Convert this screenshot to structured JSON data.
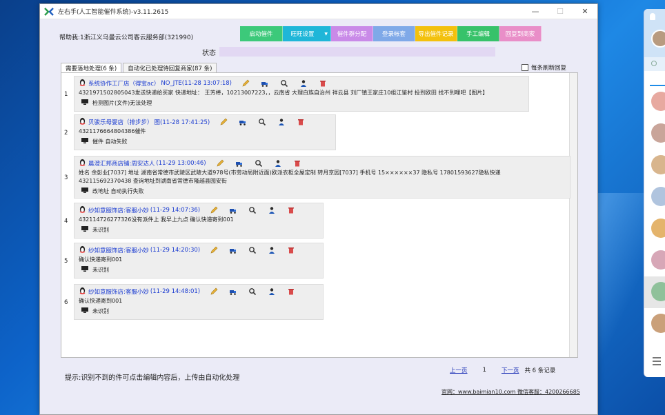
{
  "window": {
    "title": "左右手(人工智能催件系统)-v3.11.2615",
    "minimize": "—",
    "maximize": "☐",
    "close": "✕"
  },
  "account": {
    "label": "帮助我:1浙江义乌曼云公司客云服务部(321990)"
  },
  "toolbar": {
    "buttons": [
      {
        "label": "启动催件",
        "color": "#3cc97a"
      },
      {
        "label": "旺旺设置",
        "color": "#1fb6d8"
      },
      {
        "label": "催件群分配",
        "color": "#c98ae8"
      },
      {
        "label": "登录帐套",
        "color": "#7fa9e8"
      },
      {
        "label": "导出催件记录",
        "color": "#f3c10d"
      },
      {
        "label": "手工编辑",
        "color": "#37c26a"
      },
      {
        "label": "回复到商家",
        "color": "#e98ec8"
      }
    ],
    "dropdown_arrow": "▼"
  },
  "status": {
    "label": "状态"
  },
  "tabs": [
    {
      "label": "需要落地处理(6 条)",
      "active": true
    },
    {
      "label": "自动化已处理待回复商家(87 条)",
      "active": false
    }
  ],
  "refresh_option": {
    "label": "每条刷新回复",
    "checked": false
  },
  "messages": [
    {
      "num": "1",
      "shop": "系统协作工厂店（得宝ac）",
      "time": "NO_JTE(11-28 13:07:18)",
      "lines": [
        "4321971502805043发送快递给买家 快递地址： 王芳棒，10213007223，，云南省 大理白族自治州 祥云县 刘厂镇王家庄10组江鉴村 投到欧田 找不到哩吧【图片】"
      ],
      "footer": "检测图片(文件)无法处理"
    },
    {
      "num": "2",
      "shop": "贝骏乐母婴店（排步步）",
      "time": "图(11-28 17:41:25)",
      "lines": [
        "4321176664804386催件"
      ],
      "footer": "催件 自动失败"
    },
    {
      "num": "3",
      "shop": "晨澄汇邦商店铺:周安达人",
      "time": "(11-29 13:00:46)",
      "lines": [
        "姓名 余彭业[7037] 地址 湖南省常德市武陵区武陵大道978号(市劳动局附近面)欧派衣柜全屋定制 转月京园[7037] 手机号 15××××××37 隐私号 17801593627隐私快递",
        "432115692370438 查询地址到湖南省常德市隆越县园安街"
      ],
      "footer": "改地址 自动执行失败"
    },
    {
      "num": "4",
      "shop": "纱如意服饰店:客服小妙",
      "time": "(11-29 14:07:36)",
      "lines": [
        "432114726277326没有派件上 我早上九点 确认快递寄到001"
      ],
      "footer": "未识别"
    },
    {
      "num": "5",
      "shop": "纱如意服饰店:客服小妙",
      "time": "(11-29 14:20:30)",
      "lines": [
        "确认快递寄到001"
      ],
      "footer": "未识别"
    },
    {
      "num": "6",
      "shop": "纱如意服饰店:客服小妙",
      "time": "(11-29 14:48:01)",
      "lines": [
        "确认快递寄到001"
      ],
      "footer": "未识别"
    }
  ],
  "tip": {
    "text": "提示:识别不到的件可点击编辑内容后，上传由自动化处理"
  },
  "pager": {
    "prev": "上一页",
    "current": "1",
    "next": "下一页",
    "total": "共 6 条记录"
  },
  "footer": {
    "website": "官网：www.baimian10.com 微信客服：4200266685"
  },
  "icons": [
    "app-logo-icon",
    "qq-penguin-icon",
    "edit-pencil-icon",
    "truck-icon",
    "search-icon",
    "person-icon",
    "trash-icon",
    "computer-icon",
    "bell-icon"
  ]
}
